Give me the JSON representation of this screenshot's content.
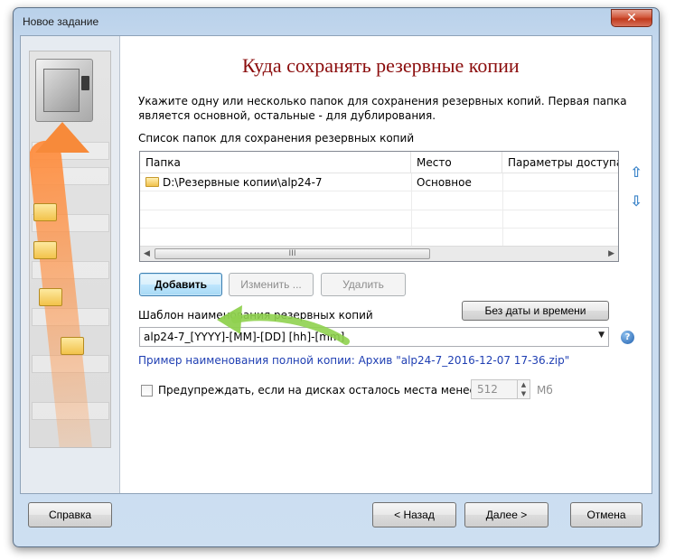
{
  "window": {
    "title": "Новое задание",
    "close_glyph": "✕"
  },
  "main": {
    "heading": "Куда сохранять резервные копии",
    "description": "Укажите одну или несколько папок для сохранения резервных копий. Первая папка является основной, остальные - для дублирования.",
    "folders_label": "Список папок для сохранения резервных копий",
    "columns": [
      "Папка",
      "Место",
      "Параметры доступа"
    ],
    "rows": [
      {
        "folder": "D:\\Резервные копии\\alp24-7",
        "place": "Основное",
        "access": ""
      }
    ],
    "scroll_thumb_grip": "III",
    "buttons": {
      "add": "Добавить",
      "edit": "Изменить ...",
      "delete": "Удалить",
      "no_datetime": "Без даты и времени"
    },
    "template_label": "Шаблон наименования резервных копий",
    "template_value": "alp24-7_[YYYY]-[MM]-[DD] [hh]-[mm]",
    "example": "Пример наименования полной копии: Архив \"alp24-7_2016-12-07 17-36.zip\"",
    "warn_label": "Предупреждать, если на дисках осталось места менее",
    "warn_value": "512",
    "warn_unit": "Мб",
    "warn_checked": false
  },
  "footer": {
    "help": "Справка",
    "back": "< Назад",
    "next": "Далее >",
    "cancel": "Отмена"
  },
  "icons": {
    "move_up": "up-arrow-icon",
    "move_down": "down-arrow-icon",
    "help": "help-icon"
  },
  "colors": {
    "heading": "#8b0d0d",
    "example_link": "#1f3fb3",
    "arrow_blue": "#3b84c9",
    "callout_green": "#8fd14f"
  }
}
